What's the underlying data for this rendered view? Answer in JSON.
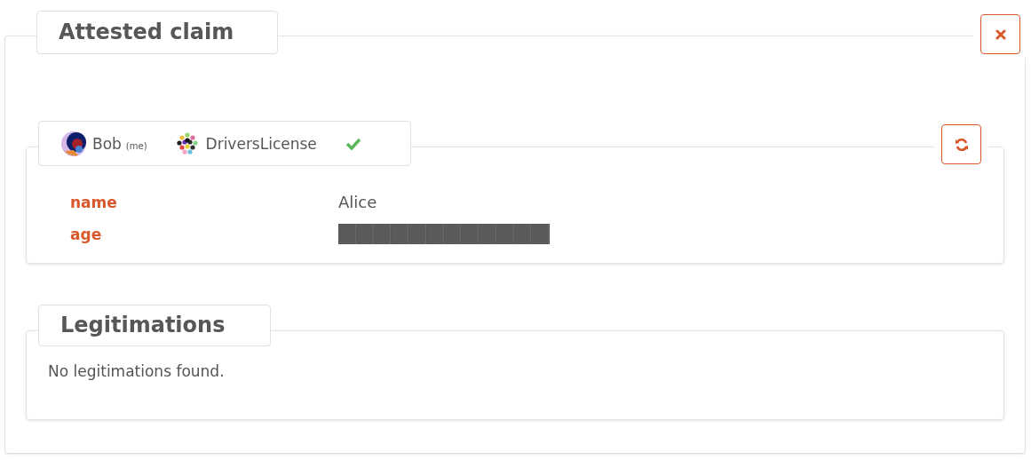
{
  "panel": {
    "title": "Attested claim"
  },
  "claim": {
    "owner": "Bob",
    "owner_note": "(me)",
    "ctype": "DriversLicense",
    "verified": true,
    "properties": [
      {
        "kind": "text",
        "label": "name",
        "value": "Alice"
      },
      {
        "kind": "redacted",
        "label": "age"
      }
    ]
  },
  "legitimations": {
    "title": "Legitimations",
    "message": "No legitimations found."
  }
}
